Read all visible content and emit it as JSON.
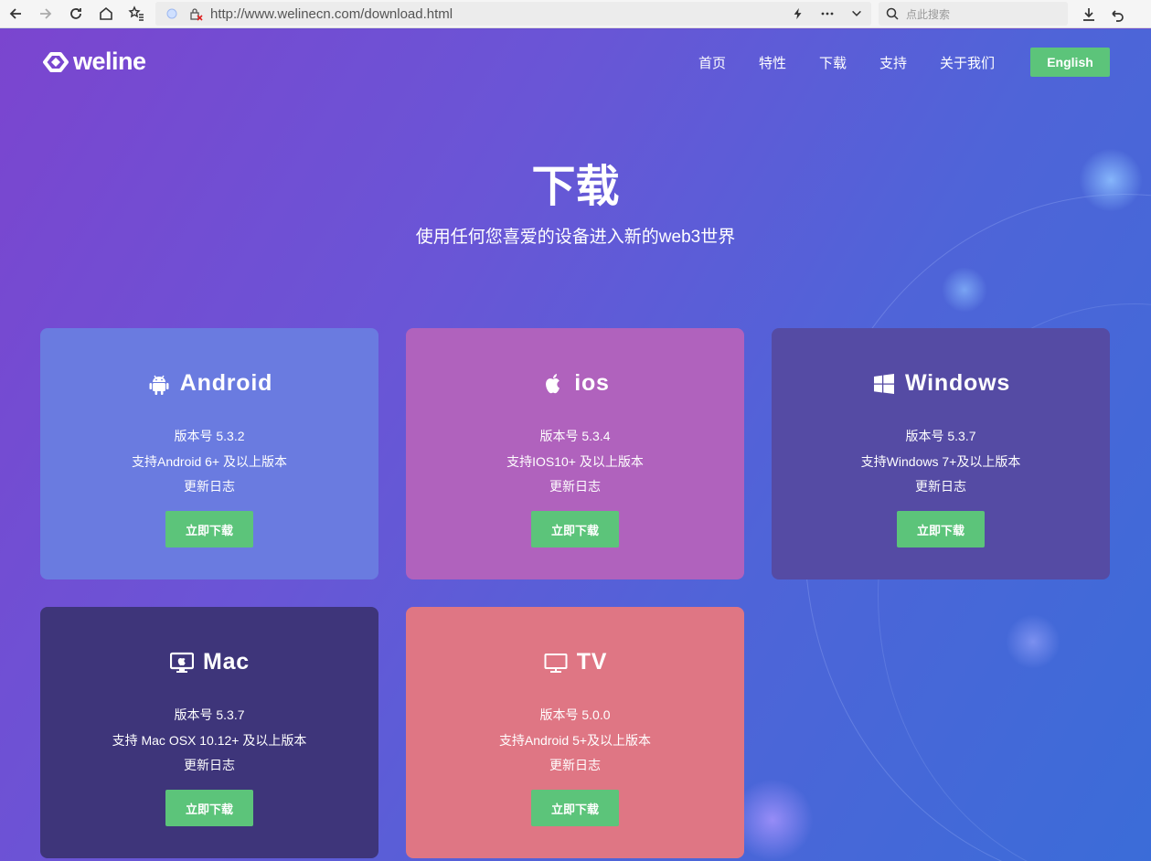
{
  "browser": {
    "url": "http://www.welinecn.com/download.html",
    "search_placeholder": "点此搜索"
  },
  "header": {
    "logo_text": "weline",
    "nav": [
      "首页",
      "特性",
      "下载",
      "支持",
      "关于我们"
    ],
    "lang_button": "English"
  },
  "hero": {
    "title": "下载",
    "subtitle": "使用任何您喜爱的设备进入新的web3世界"
  },
  "cards": [
    {
      "name": "Android",
      "icon": "android-icon",
      "version": "版本号 5.3.2",
      "support": "支持Android 6+ 及以上版本",
      "changelog": "更新日志",
      "button": "立即下载",
      "color": "#6a7be0"
    },
    {
      "name": "ios",
      "icon": "apple-icon",
      "version": "版本号 5.3.4",
      "support": "支持IOS10+ 及以上版本",
      "changelog": "更新日志",
      "button": "立即下载",
      "color": "#b062bd"
    },
    {
      "name": "Windows",
      "icon": "windows-icon",
      "version": "版本号 5.3.7",
      "support": "支持Windows 7+及以上版本",
      "changelog": "更新日志",
      "button": "立即下载",
      "color": "#554ba4"
    },
    {
      "name": "Mac",
      "icon": "mac-icon",
      "version": "版本号 5.3.7",
      "support": "支持 Mac OSX 10.12+ 及以上版本",
      "changelog": "更新日志",
      "button": "立即下载",
      "color": "#3e357a"
    },
    {
      "name": "TV",
      "icon": "tv-icon",
      "version": "版本号 5.0.0",
      "support": "支持Android 5+及以上版本",
      "changelog": "更新日志",
      "button": "立即下载",
      "color": "#df7684"
    }
  ],
  "colors": {
    "accent_green": "#5cc47a"
  }
}
